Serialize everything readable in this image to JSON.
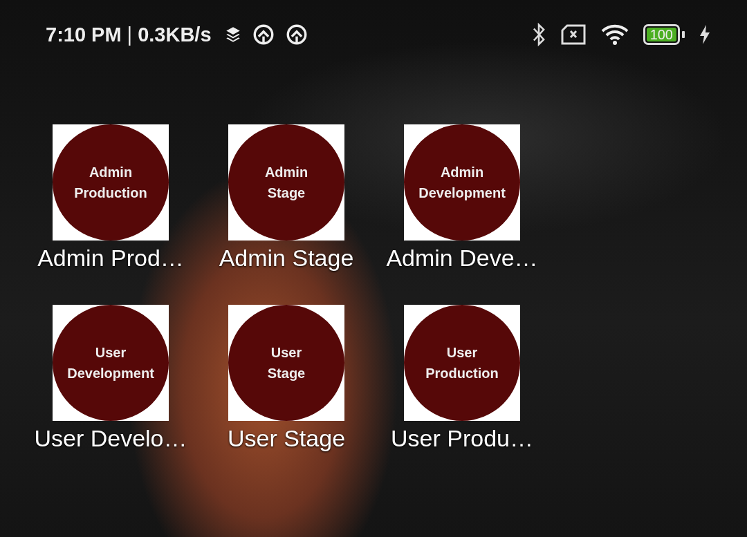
{
  "status_bar": {
    "time": "7:10 PM",
    "separator": "|",
    "speed": "0.3KB/s",
    "battery": "100"
  },
  "apps": [
    {
      "label": "Admin Prod…",
      "icon_lines": [
        "Admin",
        "Production"
      ]
    },
    {
      "label": "Admin Stage",
      "icon_lines": [
        "Admin",
        "Stage"
      ]
    },
    {
      "label": "Admin Deve…",
      "icon_lines": [
        "Admin",
        "Development"
      ]
    },
    {
      "label": "User Develo…",
      "icon_lines": [
        "User",
        "Development"
      ]
    },
    {
      "label": "User Stage",
      "icon_lines": [
        "User",
        "Stage"
      ]
    },
    {
      "label": "User Produ…",
      "icon_lines": [
        "User",
        "Production"
      ]
    }
  ]
}
